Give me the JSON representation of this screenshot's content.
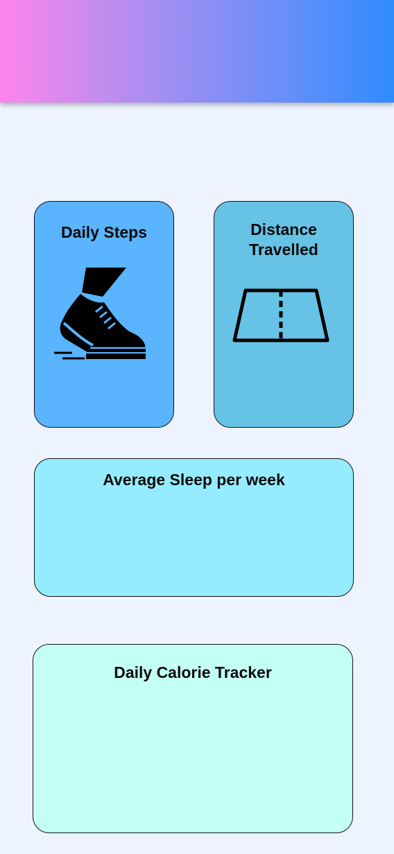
{
  "header": {
    "gradient": [
      "#fd86ec",
      "#2f8cfc"
    ]
  },
  "cards": {
    "steps": {
      "title": "Daily Steps",
      "icon": "shoe-icon",
      "color": "#5ab4fe"
    },
    "distance": {
      "title": "Distance Travelled",
      "icon": "road-icon",
      "color": "#67c3e6"
    },
    "sleep": {
      "title": "Average Sleep per week",
      "color": "#95ecfe"
    },
    "calorie": {
      "title": "Daily Calorie Tracker",
      "color": "#c4fff6"
    }
  }
}
